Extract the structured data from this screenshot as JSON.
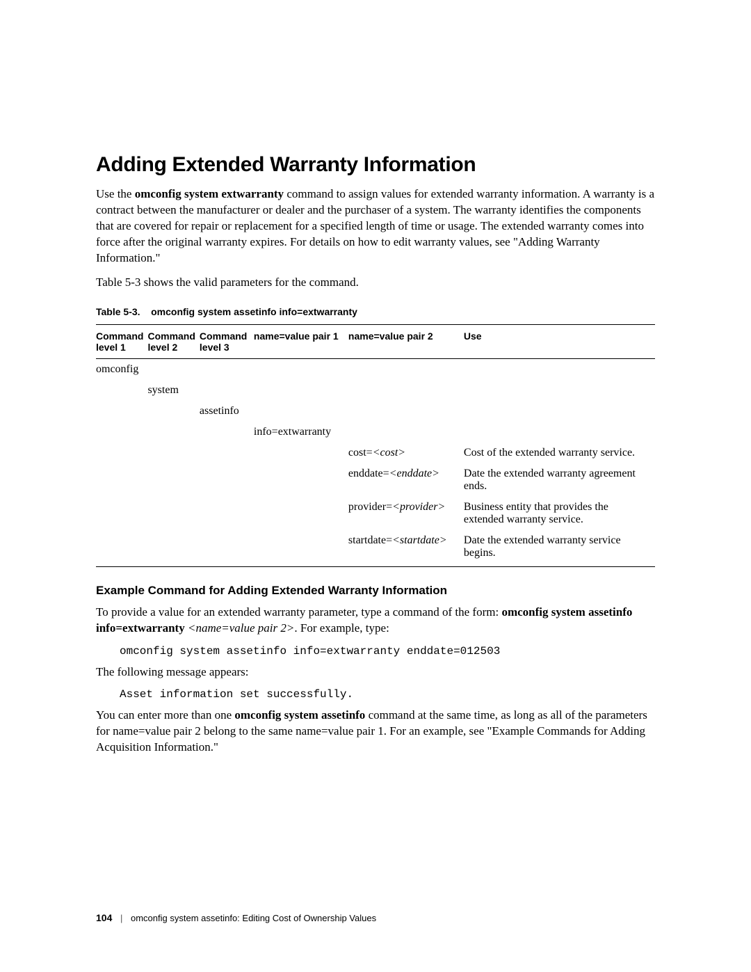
{
  "heading": "Adding Extended Warranty Information",
  "intro_prefix": "Use the",
  "intro_cmd": "omconfig system extwarranty",
  "intro_rest": "command to assign values for extended warranty information. A warranty is a contract between the manufacturer or dealer and the purchaser of a system. The warranty identifies the components that are covered for repair or replacement for a specified length of time or usage. The extended warranty comes into force after the original warranty expires. For details on how to edit warranty values, see \"Adding Warranty Information.\"",
  "table_ref": "Table 5-3 shows the valid parameters for the command.",
  "table_caption_prefix": "Table 5-3.",
  "table_caption_title": "omconfig system assetinfo info=extwarranty",
  "th": {
    "l1a": "Command",
    "l1b": "level 1",
    "l2a": "Command",
    "l2b": "level 2",
    "l3a": "Command",
    "l3b": "level 3",
    "p1": "name=value pair 1",
    "p2": "name=value pair 2",
    "use": "Use"
  },
  "rows": {
    "level1": "omconfig",
    "level2": "system",
    "level3": "assetinfo",
    "pair1": "info=extwarranty",
    "r1_p2_a": "cost=",
    "r1_p2_b": "<cost>",
    "r1_use": "Cost of the extended warranty service.",
    "r2_p2_a": "enddate=",
    "r2_p2_b": "<enddate>",
    "r2_use": "Date the extended warranty agreement ends.",
    "r3_p2_a": "provider=",
    "r3_p2_b": "<provider>",
    "r3_use": "Business entity that provides the extended warranty service.",
    "r4_p2_a": "startdate=",
    "r4_p2_b": "<startdate>",
    "r4_use": "Date the extended warranty service begins."
  },
  "subhead": "Example Command for Adding Extended Warranty Information",
  "example_intro_a": "To provide a value for an extended warranty parameter, type a command of the form:",
  "example_intro_b": "omconfig system assetinfo info=extwarranty",
  "example_intro_c": "<name=value pair 2>",
  "example_intro_d": ". For example, type:",
  "code1": "omconfig system assetinfo info=extwarranty enddate=012503",
  "msg_intro": "The following message appears:",
  "code2": "Asset information set successfully.",
  "closing_a": "You can enter more than one",
  "closing_b": "omconfig system assetinfo",
  "closing_c": "command at the same time, as long as all of the parameters for name=value pair 2 belong to the same name=value pair 1. For an example, see \"Example Commands for Adding Acquisition Information.\"",
  "footer": {
    "page": "104",
    "title": "omconfig system assetinfo: Editing Cost of Ownership Values"
  }
}
